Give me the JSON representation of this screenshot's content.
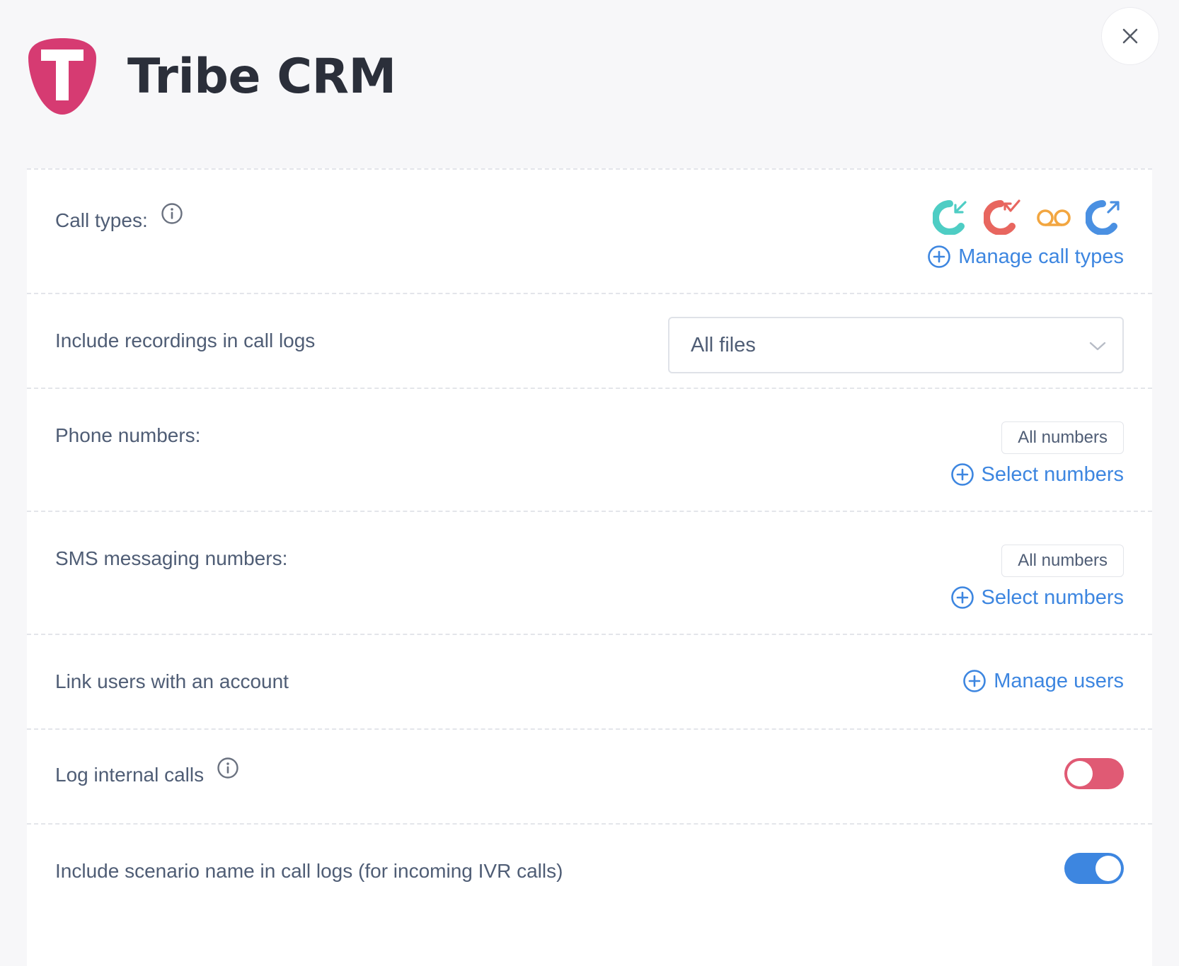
{
  "app": {
    "title": "Tribe CRM",
    "logo_letter": "T"
  },
  "colors": {
    "brand": "#d63b72",
    "link": "#3d86e0",
    "toggle_off": "#e05a74",
    "toggle_on": "#3d86e0",
    "incoming": "#4ecdc4",
    "missed": "#e8665f",
    "voicemail": "#f2a640",
    "outgoing": "#4a90e2"
  },
  "settings": {
    "call_types": {
      "label": "Call types:",
      "icons": [
        "incoming-call-icon",
        "missed-call-icon",
        "voicemail-icon",
        "outgoing-call-icon"
      ],
      "manage_label": "Manage call types"
    },
    "recordings": {
      "label": "Include recordings in call logs",
      "selected": "All files"
    },
    "phone_numbers": {
      "label": "Phone numbers:",
      "chip": "All numbers",
      "select_label": "Select numbers"
    },
    "sms_numbers": {
      "label": "SMS messaging numbers:",
      "chip": "All numbers",
      "select_label": "Select numbers"
    },
    "link_users": {
      "label": "Link users with an account",
      "manage_label": "Manage users"
    },
    "internal_calls": {
      "label": "Log internal calls",
      "enabled": false
    },
    "scenario_name": {
      "label": "Include scenario name in call logs (for incoming IVR calls)",
      "enabled": true
    }
  }
}
